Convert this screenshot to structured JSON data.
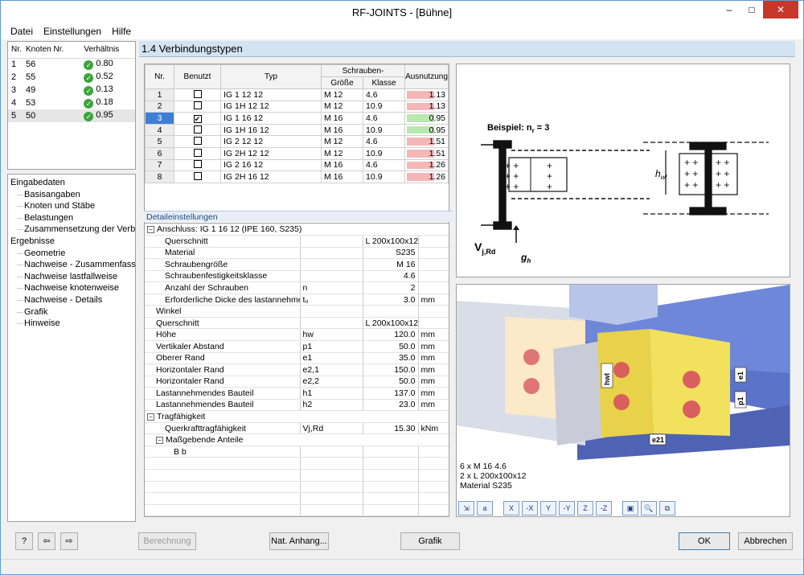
{
  "window": {
    "title": "RF-JOINTS - [Bühne]",
    "controls": [
      "–",
      "□",
      "✕"
    ]
  },
  "menu": [
    "Datei",
    "Einstellungen",
    "Hilfe"
  ],
  "nodes": {
    "headers": [
      "Nr.",
      "Knoten Nr.",
      "Verhältnis"
    ],
    "rows": [
      {
        "nr": "1",
        "knoten": "56",
        "ratio": "0.80"
      },
      {
        "nr": "2",
        "knoten": "55",
        "ratio": "0.52"
      },
      {
        "nr": "3",
        "knoten": "49",
        "ratio": "0.13"
      },
      {
        "nr": "4",
        "knoten": "53",
        "ratio": "0.18"
      },
      {
        "nr": "5",
        "knoten": "50",
        "ratio": "0.95"
      }
    ]
  },
  "tree": [
    {
      "label": "Eingabedaten",
      "level": 0
    },
    {
      "label": "Basisangaben",
      "level": 1
    },
    {
      "label": "Knoten und Stäbe",
      "level": 1
    },
    {
      "label": "Belastungen",
      "level": 1
    },
    {
      "label": "Zusammensetzung der Verbindung",
      "level": 1
    },
    {
      "label": "Ergebnisse",
      "level": 0
    },
    {
      "label": "Geometrie",
      "level": 1
    },
    {
      "label": "Nachweise - Zusammenfassung",
      "level": 1
    },
    {
      "label": "Nachweise lastfallweise",
      "level": 1
    },
    {
      "label": "Nachweise knotenweise",
      "level": 1
    },
    {
      "label": "Nachweise - Details",
      "level": 1
    },
    {
      "label": "Grafik",
      "level": 1
    },
    {
      "label": "Hinweise",
      "level": 1
    }
  ],
  "section": {
    "title": "1.4 Verbindungstypen"
  },
  "types": {
    "headers": {
      "nr": "Nr.",
      "benutzt": "Benutzt",
      "typ": "Typ",
      "schrauben": "Schrauben-",
      "groesse": "Größe",
      "klasse": "Klasse",
      "ausnutzung": "Ausnutzung"
    },
    "rows": [
      {
        "nr": "1",
        "checked": false,
        "typ": "IG 1 12 12",
        "groesse": "M 12",
        "klasse": "4.6",
        "ausnutzung": "1.13",
        "util": 1.13
      },
      {
        "nr": "2",
        "checked": false,
        "typ": "IG 1H 12 12",
        "groesse": "M 12",
        "klasse": "10.9",
        "ausnutzung": "1.13",
        "util": 1.13
      },
      {
        "nr": "3",
        "checked": true,
        "typ": "IG 1 16 12",
        "groesse": "M 16",
        "klasse": "4.6",
        "ausnutzung": "0.95",
        "util": 0.95
      },
      {
        "nr": "4",
        "checked": false,
        "typ": "IG 1H 16 12",
        "groesse": "M 16",
        "klasse": "10.9",
        "ausnutzung": "0.95",
        "util": 0.95
      },
      {
        "nr": "5",
        "checked": false,
        "typ": "IG 2 12 12",
        "groesse": "M 12",
        "klasse": "4.6",
        "ausnutzung": "1.51",
        "util": 1.51
      },
      {
        "nr": "6",
        "checked": false,
        "typ": "IG 2H 12 12",
        "groesse": "M 12",
        "klasse": "10.9",
        "ausnutzung": "1.51",
        "util": 1.51
      },
      {
        "nr": "7",
        "checked": false,
        "typ": "IG 2 16 12",
        "groesse": "M 16",
        "klasse": "4.6",
        "ausnutzung": "1.26",
        "util": 1.26
      },
      {
        "nr": "8",
        "checked": false,
        "typ": "IG 2H 16 12",
        "groesse": "M 16",
        "klasse": "10.9",
        "ausnutzung": "1.26",
        "util": 1.26
      }
    ],
    "current": "3",
    "colors": {
      "over": "#f4b6b6",
      "ok": "#b9e7b0"
    }
  },
  "details": {
    "label": "Detaileinstellungen",
    "rows": [
      {
        "k": "Anschluss: IG 1 16 12 (IPE 160, S235)",
        "s": "",
        "v": "",
        "u": "",
        "ind": 0,
        "exp": "−",
        "span": true
      },
      {
        "k": "Querschnitt",
        "s": "",
        "v": "L 200x100x12",
        "u": "",
        "ind": 2
      },
      {
        "k": "Material",
        "s": "",
        "v": "S235",
        "u": "",
        "ind": 2
      },
      {
        "k": "Schraubengröße",
        "s": "",
        "v": "M 16",
        "u": "",
        "ind": 2
      },
      {
        "k": "Schraubenfestigkeitsklasse",
        "s": "",
        "v": "4.6",
        "u": "",
        "ind": 2
      },
      {
        "k": "Anzahl der Schrauben",
        "s": "n",
        "v": "2",
        "u": "",
        "ind": 2
      },
      {
        "k": "Erforderliche Dicke des lastannehmenden",
        "s": "tᵤ",
        "v": "3.0",
        "u": "mm",
        "ind": 2
      },
      {
        "k": "Winkel",
        "s": "",
        "v": "",
        "u": "",
        "ind": 1
      },
      {
        "k": "Querschnitt",
        "s": "",
        "v": "L 200x100x12",
        "u": "",
        "ind": 1
      },
      {
        "k": "Höhe",
        "s": "hw",
        "v": "120.0",
        "u": "mm",
        "ind": 1
      },
      {
        "k": "Vertikaler Abstand",
        "s": "p1",
        "v": "50.0",
        "u": "mm",
        "ind": 1
      },
      {
        "k": "Oberer Rand",
        "s": "e1",
        "v": "35.0",
        "u": "mm",
        "ind": 1
      },
      {
        "k": "Horizontaler Rand",
        "s": "e2,1",
        "v": "150.0",
        "u": "mm",
        "ind": 1
      },
      {
        "k": "Horizontaler Rand",
        "s": "e2,2",
        "v": "50.0",
        "u": "mm",
        "ind": 1
      },
      {
        "k": "Lastannehmendes Bauteil",
        "s": "h1",
        "v": "137.0",
        "u": "mm",
        "ind": 1
      },
      {
        "k": "Lastannehmendes Bauteil",
        "s": "h2",
        "v": "23.0",
        "u": "mm",
        "ind": 1
      },
      {
        "k": "Tragfähigkeit",
        "s": "",
        "v": "",
        "u": "",
        "ind": 0,
        "exp": "−",
        "span": true
      },
      {
        "k": "Querkrafttragfähigkeit",
        "s": "Vj,Rd",
        "v": "15.30",
        "u": "kNm",
        "ind": 2
      },
      {
        "k": "Maßgebende Anteile",
        "s": "",
        "v": "",
        "u": "",
        "ind": 1,
        "exp": "−",
        "span": true
      },
      {
        "k": "B b",
        "s": "",
        "v": "",
        "u": "",
        "ind": 3
      },
      {
        "k": "",
        "s": "",
        "v": "",
        "u": "",
        "ind": 0
      },
      {
        "k": "",
        "s": "",
        "v": "",
        "u": "",
        "ind": 0
      },
      {
        "k": "",
        "s": "",
        "v": "",
        "u": "",
        "ind": 0
      },
      {
        "k": "",
        "s": "",
        "v": "",
        "u": "",
        "ind": 0
      },
      {
        "k": "",
        "s": "",
        "v": "",
        "u": "",
        "ind": 0
      }
    ]
  },
  "sketch": {
    "beispiel": "Beispiel: n",
    "beispiel_sub": "r",
    "beispiel_tail": " = 3",
    "hwl": "h",
    "hwl_sub": "wl",
    "vjrd": "V",
    "vjrd_sub": "j,Rd",
    "gh": "g",
    "gh_sub": "h"
  },
  "render": {
    "caption": [
      "6 x M 16 4.6",
      "2 x L 200x100x12",
      "Material S235"
    ],
    "dims": {
      "hwl": "hwl",
      "e1": "e1",
      "p1": "p1",
      "e21": "e21"
    },
    "tools": [
      "⇲",
      "a",
      "X",
      "-X",
      "Y",
      "-Y",
      "Z",
      "-Z",
      "▣",
      "🔍",
      "⧉"
    ]
  },
  "buttons": {
    "berechnung": "Berechnung",
    "anhang": "Nat. Anhang...",
    "grafik": "Grafik",
    "ok": "OK",
    "abbrechen": "Abbrechen",
    "icons": [
      "?",
      "⇦",
      "⇨"
    ]
  }
}
